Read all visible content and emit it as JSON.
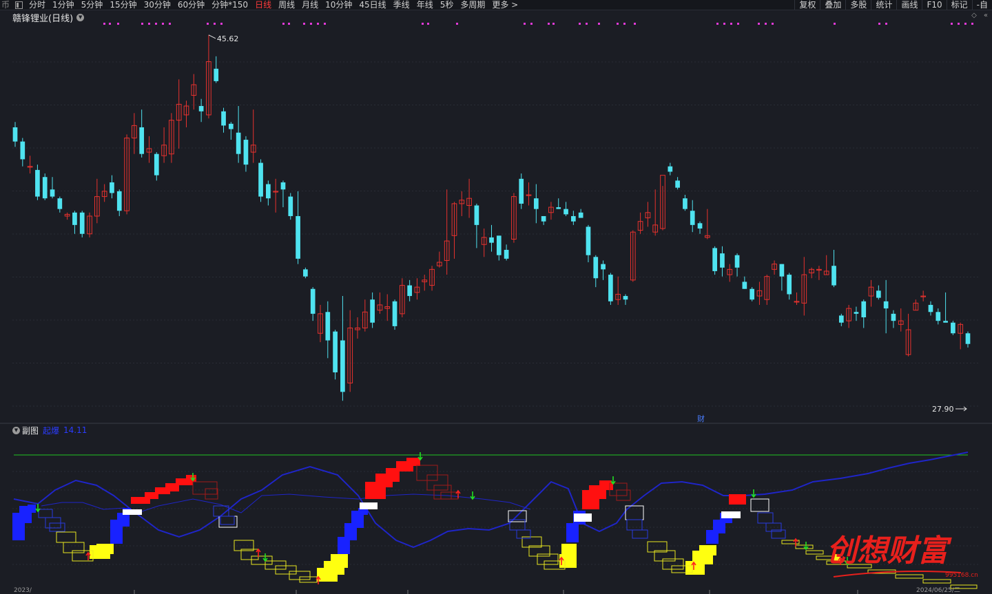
{
  "toolbar": {
    "left_edge": "币",
    "periods": [
      "分时",
      "1分钟",
      "5分钟",
      "15分钟",
      "30分钟",
      "60分钟",
      "分钟*150",
      "日线",
      "周线",
      "月线",
      "10分钟",
      "45日线",
      "季线",
      "年线",
      "5秒",
      "多周期",
      "更多 >"
    ],
    "active_period": "日线",
    "tools": [
      "复权",
      "叠加",
      "多股",
      "统计",
      "画线",
      "F10",
      "标记",
      "-自"
    ]
  },
  "symbol": {
    "name": "赣锋锂业",
    "period_tag": "(日线)"
  },
  "main_chart": {
    "high_label": "45.62",
    "low_label": "27.90",
    "marker": "财",
    "up_color": "#e8322e",
    "down_color": "#4fe3f0",
    "candles": [
      [
        40.0,
        40.3,
        38.9,
        39.2
      ],
      [
        39.2,
        39.4,
        37.8,
        38.2
      ],
      [
        37.8,
        38.4,
        37.4,
        37.8
      ],
      [
        37.6,
        37.9,
        35.9,
        36.1
      ],
      [
        37.2,
        37.4,
        35.9,
        36.0
      ],
      [
        36.5,
        37.2,
        36.0,
        36.1
      ],
      [
        36.0,
        36.1,
        35.2,
        35.4
      ],
      [
        35.0,
        35.2,
        34.8,
        35.1
      ],
      [
        35.2,
        35.3,
        34.0,
        34.5
      ],
      [
        35.2,
        35.3,
        33.8,
        34.0
      ],
      [
        34.0,
        35.2,
        33.8,
        35.0
      ],
      [
        35.0,
        37.1,
        34.6,
        36.1
      ],
      [
        36.1,
        36.8,
        35.8,
        36.4
      ],
      [
        36.9,
        37.3,
        36.0,
        36.3
      ],
      [
        36.4,
        36.5,
        35.0,
        35.3
      ],
      [
        35.3,
        39.6,
        35.1,
        39.4
      ],
      [
        39.4,
        40.8,
        38.5,
        40.1
      ],
      [
        40.0,
        41.0,
        38.3,
        38.5
      ],
      [
        38.6,
        39.5,
        38.0,
        38.8
      ],
      [
        38.5,
        38.6,
        37.0,
        37.3
      ],
      [
        38.4,
        40.0,
        38.0,
        39.0
      ],
      [
        38.5,
        40.8,
        38.0,
        40.4
      ],
      [
        40.4,
        42.7,
        38.8,
        41.3
      ],
      [
        40.7,
        41.5,
        40.0,
        41.2
      ],
      [
        41.8,
        43.0,
        41.0,
        42.4
      ],
      [
        41.2,
        41.6,
        40.3,
        40.9
      ],
      [
        40.7,
        45.2,
        40.5,
        43.7
      ],
      [
        43.3,
        44.0,
        42.5,
        42.6
      ],
      [
        40.9,
        41.1,
        39.7,
        40.1
      ],
      [
        40.2,
        40.3,
        39.3,
        39.9
      ],
      [
        39.7,
        41.2,
        38.0,
        38.5
      ],
      [
        39.3,
        39.5,
        37.5,
        37.9
      ],
      [
        38.6,
        41.0,
        38.0,
        39.0
      ],
      [
        38.0,
        38.2,
        35.8,
        36.1
      ],
      [
        36.8,
        37.0,
        35.6,
        36.0
      ],
      [
        36.4,
        37.1,
        35.2,
        36.4
      ],
      [
        36.9,
        37.0,
        35.5,
        36.5
      ],
      [
        36.1,
        36.3,
        34.8,
        35.0
      ],
      [
        35.0,
        36.4,
        32.3,
        32.6
      ],
      [
        32.0,
        32.1,
        31.5,
        31.6
      ],
      [
        30.9,
        31.0,
        29.1,
        29.5
      ],
      [
        28.4,
        30.0,
        27.9,
        29.5
      ],
      [
        29.6,
        30.2,
        27.0,
        28.0
      ],
      [
        28.5,
        28.6,
        25.8,
        26.2
      ],
      [
        28.0,
        30.5,
        24.6,
        25.1
      ],
      [
        25.6,
        29.7,
        25.1,
        28.7
      ],
      [
        28.6,
        29.3,
        28.1,
        28.7
      ],
      [
        28.7,
        30.3,
        28.5,
        29.6
      ],
      [
        30.3,
        30.7,
        28.7,
        29.0
      ],
      [
        29.7,
        30.7,
        29.5,
        30.0
      ],
      [
        29.8,
        30.6,
        29.1,
        29.9
      ],
      [
        30.2,
        30.3,
        28.6,
        28.8
      ],
      [
        29.5,
        31.5,
        29.3,
        31.1
      ],
      [
        31.1,
        31.4,
        30.2,
        30.5
      ],
      [
        30.7,
        31.5,
        30.3,
        31.0
      ],
      [
        31.3,
        31.7,
        30.8,
        31.4
      ],
      [
        31.1,
        32.2,
        30.8,
        32.0
      ],
      [
        32.2,
        33.0,
        32.1,
        32.4
      ],
      [
        32.5,
        36.5,
        31.7,
        33.6
      ],
      [
        33.9,
        35.8,
        32.6,
        35.7
      ],
      [
        35.7,
        36.4,
        35.0,
        35.9
      ],
      [
        35.6,
        37.1,
        34.9,
        36.0
      ],
      [
        35.6,
        35.7,
        33.2,
        34.5
      ],
      [
        33.4,
        34.3,
        32.7,
        33.8
      ],
      [
        33.8,
        34.5,
        33.0,
        33.5
      ],
      [
        33.9,
        33.9,
        32.5,
        32.8
      ],
      [
        33.1,
        33.4,
        32.5,
        32.6
      ],
      [
        33.7,
        36.3,
        33.5,
        36.1
      ],
      [
        37.1,
        37.4,
        35.4,
        35.7
      ],
      [
        36.2,
        36.9,
        35.6,
        36.2
      ],
      [
        36.0,
        36.8,
        34.6,
        35.4
      ],
      [
        35.0,
        35.0,
        34.5,
        34.7
      ],
      [
        35.2,
        35.8,
        34.8,
        35.5
      ],
      [
        35.5,
        36.0,
        35.4,
        35.4
      ],
      [
        35.4,
        35.8,
        35.0,
        35.1
      ],
      [
        35.0,
        35.3,
        34.5,
        34.7
      ],
      [
        35.2,
        35.4,
        34.9,
        34.9
      ],
      [
        34.4,
        34.5,
        32.4,
        32.8
      ],
      [
        32.7,
        32.8,
        31.0,
        31.5
      ],
      [
        32.3,
        32.5,
        31.4,
        32.0
      ],
      [
        31.7,
        31.8,
        30.0,
        30.2
      ],
      [
        30.3,
        31.6,
        30.0,
        30.6
      ],
      [
        30.5,
        30.6,
        30.0,
        30.3
      ],
      [
        31.4,
        34.2,
        31.3,
        34.1
      ],
      [
        34.2,
        35.2,
        34.0,
        34.7
      ],
      [
        34.9,
        35.8,
        34.4,
        35.2
      ],
      [
        34.1,
        36.5,
        33.9,
        34.5
      ],
      [
        34.3,
        36.7,
        34.2,
        37.3
      ],
      [
        37.8,
        38.0,
        37.3,
        37.5
      ],
      [
        37.0,
        37.2,
        36.5,
        36.6
      ],
      [
        36.0,
        36.2,
        35.3,
        35.4
      ],
      [
        35.3,
        35.9,
        34.1,
        34.5
      ],
      [
        34.6,
        34.7,
        34.0,
        34.3
      ],
      [
        33.8,
        35.4,
        33.7,
        33.9
      ],
      [
        33.2,
        33.3,
        31.7,
        31.9
      ],
      [
        32.9,
        33.3,
        31.6,
        32.1
      ],
      [
        31.7,
        32.3,
        31.3,
        32.0
      ],
      [
        32.8,
        32.9,
        31.6,
        32.1
      ],
      [
        31.3,
        31.6,
        30.9,
        30.9
      ],
      [
        30.9,
        31.0,
        30.2,
        30.3
      ],
      [
        30.5,
        31.3,
        30.0,
        30.8
      ],
      [
        30.3,
        31.7,
        30.0,
        31.6
      ],
      [
        32.0,
        32.5,
        31.7,
        32.3
      ],
      [
        32.3,
        32.3,
        30.8,
        31.6
      ],
      [
        31.7,
        31.8,
        30.3,
        30.6
      ],
      [
        30.2,
        30.7,
        30.0,
        30.2
      ],
      [
        30.1,
        32.7,
        29.4,
        31.7
      ],
      [
        31.8,
        32.1,
        31.5,
        32.0
      ],
      [
        32.0,
        32.2,
        31.4,
        32.0
      ],
      [
        31.7,
        32.8,
        31.7,
        31.9
      ],
      [
        32.2,
        33.1,
        31.0,
        31.1
      ],
      [
        29.4,
        29.5,
        28.8,
        29.0
      ],
      [
        29.1,
        30.0,
        28.7,
        29.8
      ],
      [
        29.6,
        29.9,
        29.1,
        29.5
      ],
      [
        30.2,
        30.3,
        28.7,
        29.3
      ],
      [
        30.5,
        31.4,
        29.9,
        31.0
      ],
      [
        30.8,
        31.1,
        30.3,
        30.4
      ],
      [
        30.2,
        31.4,
        28.4,
        29.8
      ],
      [
        29.5,
        29.7,
        28.7,
        29.1
      ],
      [
        28.9,
        29.8,
        28.5,
        29.1
      ],
      [
        27.2,
        29.5,
        27.1,
        28.6
      ],
      [
        29.7,
        30.3,
        29.7,
        30.1
      ],
      [
        30.5,
        30.8,
        30.2,
        30.5
      ],
      [
        30.0,
        30.2,
        29.4,
        29.6
      ],
      [
        29.6,
        29.8,
        28.9,
        29.1
      ],
      [
        29.1,
        30.7,
        29.1,
        29.0
      ],
      [
        29.0,
        29.1,
        28.3,
        28.4
      ],
      [
        28.4,
        29.0,
        27.5,
        28.9
      ],
      [
        28.4,
        28.5,
        27.6,
        27.8
      ]
    ]
  },
  "sub_chart": {
    "label": "副图",
    "indicator": "起爆",
    "indicator_param": "14.11"
  },
  "bottom_axis": {
    "date_right": "2024/06/25/二",
    "left_partial": "2023/"
  },
  "watermark": {
    "text": "创想财富",
    "site": "995168.cn"
  }
}
